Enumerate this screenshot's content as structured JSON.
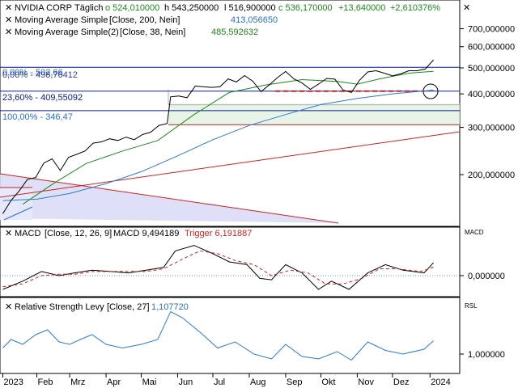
{
  "colors": {
    "price": "#000000",
    "sma200": "#2a7bd4",
    "sma38": "#1a8a1a",
    "fib_line": "#0a1a8a",
    "red_line": "#cc2222",
    "macd": "#000000",
    "trigger": "#cc2222",
    "rsl": "#2a7bd4",
    "green_label": "#1a8a1a",
    "blue_label": "#2a6fd0",
    "red_label": "#cc2222",
    "fib_text": "#0a1a8a"
  },
  "header": {
    "symbol": "NVIDIA CORP",
    "period": "Täglich",
    "open": "o 524,010000",
    "high": "h 543,250000",
    "low": "l 516,900000",
    "close": "c 536,170000",
    "change": "+13,640000",
    "change_pct": "+2,610376%",
    "sma1_label": "Moving Average Simple",
    "sma1_params": "[Close, 200, Nein]",
    "sma1_value": "413,056650",
    "sma2_label": "Moving Average Simple(2)",
    "sma2_params": "[Close, 38, Nein]",
    "sma2_value": "485,592632",
    "close_icon": "close-x"
  },
  "price_axis": {
    "ticks": [
      "700,000000",
      "600,000000",
      "500,000000",
      "400,000000",
      "300,000000",
      "200,000000"
    ]
  },
  "fib_levels": {
    "label_0": "0,00% - 502,66",
    "label_0b": "0,00% - 498,76412",
    "label_236": "23,60% - 409,55092",
    "label_100": "100,00% - 346,47"
  },
  "macd": {
    "label": "MACD",
    "params": "[Close, 12, 26, 9]",
    "value_text": "MACD 9,494189",
    "trigger_text": "Trigger 6,191887",
    "axis_title": "MACD",
    "axis_zero": "0,000000"
  },
  "rsl": {
    "label": "Relative Strength Levy",
    "params": "[Close, 27]",
    "value": "1,107720",
    "axis_title": "RSL",
    "axis_one": "1,000000"
  },
  "x_axis": {
    "labels": [
      "2023",
      "Feb",
      "Mrz",
      "Apr",
      "Mai",
      "Jun",
      "Jul",
      "Aug",
      "Sep",
      "Okt",
      "Nov",
      "Dez",
      "2024"
    ]
  },
  "chart_data": {
    "type": "line",
    "title": "NVIDIA CORP",
    "ylim": [
      130,
      760
    ],
    "y_scale": "log",
    "grid": false,
    "price_close": [
      [
        "2023-01-03",
        143
      ],
      [
        "2023-01-10",
        160
      ],
      [
        "2023-01-17",
        174
      ],
      [
        "2023-01-24",
        192
      ],
      [
        "2023-01-31",
        195
      ],
      [
        "2023-02-07",
        221
      ],
      [
        "2023-02-14",
        229
      ],
      [
        "2023-02-21",
        207
      ],
      [
        "2023-02-28",
        232
      ],
      [
        "2023-03-07",
        238
      ],
      [
        "2023-03-14",
        245
      ],
      [
        "2023-03-21",
        262
      ],
      [
        "2023-03-28",
        265
      ],
      [
        "2023-04-04",
        272
      ],
      [
        "2023-04-11",
        268
      ],
      [
        "2023-04-18",
        276
      ],
      [
        "2023-04-25",
        270
      ],
      [
        "2023-05-02",
        282
      ],
      [
        "2023-05-09",
        288
      ],
      [
        "2023-05-16",
        305
      ],
      [
        "2023-05-23",
        310
      ],
      [
        "2023-05-26",
        390
      ],
      [
        "2023-06-02",
        393
      ],
      [
        "2023-06-09",
        387
      ],
      [
        "2023-06-16",
        428
      ],
      [
        "2023-06-23",
        425
      ],
      [
        "2023-06-30",
        423
      ],
      [
        "2023-07-07",
        425
      ],
      [
        "2023-07-14",
        455
      ],
      [
        "2023-07-21",
        443
      ],
      [
        "2023-07-28",
        468
      ],
      [
        "2023-08-04",
        446
      ],
      [
        "2023-08-11",
        408
      ],
      [
        "2023-08-18",
        432
      ],
      [
        "2023-08-25",
        460
      ],
      [
        "2023-09-01",
        485
      ],
      [
        "2023-09-08",
        455
      ],
      [
        "2023-09-15",
        439
      ],
      [
        "2023-09-22",
        416
      ],
      [
        "2023-09-29",
        435
      ],
      [
        "2023-10-06",
        457
      ],
      [
        "2023-10-13",
        454
      ],
      [
        "2023-10-20",
        413
      ],
      [
        "2023-10-27",
        405
      ],
      [
        "2023-11-03",
        450
      ],
      [
        "2023-11-10",
        483
      ],
      [
        "2023-11-17",
        488
      ],
      [
        "2023-11-24",
        478
      ],
      [
        "2023-12-01",
        467
      ],
      [
        "2023-12-08",
        475
      ],
      [
        "2023-12-15",
        488
      ],
      [
        "2023-12-22",
        488
      ],
      [
        "2023-12-29",
        495
      ],
      [
        "2024-01-05",
        536
      ]
    ],
    "sma200": [
      [
        "2023-01-03",
        160
      ],
      [
        "2023-02-01",
        162
      ],
      [
        "2023-03-01",
        170
      ],
      [
        "2023-04-01",
        185
      ],
      [
        "2023-05-01",
        205
      ],
      [
        "2023-06-01",
        235
      ],
      [
        "2023-07-01",
        270
      ],
      [
        "2023-08-01",
        305
      ],
      [
        "2023-09-01",
        335
      ],
      [
        "2023-10-01",
        365
      ],
      [
        "2023-11-01",
        385
      ],
      [
        "2023-12-01",
        400
      ],
      [
        "2024-01-05",
        413.06
      ]
    ],
    "sma38": [
      [
        "2023-01-20",
        155
      ],
      [
        "2023-02-15",
        185
      ],
      [
        "2023-03-15",
        220
      ],
      [
        "2023-04-15",
        245
      ],
      [
        "2023-05-15",
        268
      ],
      [
        "2023-06-15",
        335
      ],
      [
        "2023-07-15",
        405
      ],
      [
        "2023-08-15",
        432
      ],
      [
        "2023-09-15",
        452
      ],
      [
        "2023-10-15",
        445
      ],
      [
        "2023-11-01",
        435
      ],
      [
        "2023-11-20",
        455
      ],
      [
        "2023-12-15",
        478
      ],
      [
        "2024-01-05",
        485.59
      ]
    ],
    "fib_levels": [
      502.66,
      498.76412,
      409.55092,
      346.47
    ],
    "horizontal_lines": [
      502.66,
      409.55,
      346.47,
      307
    ],
    "macd_series": [
      [
        "2023-01-03",
        -10
      ],
      [
        "2023-01-20",
        -4
      ],
      [
        "2023-02-05",
        3
      ],
      [
        "2023-02-20",
        0
      ],
      [
        "2023-03-05",
        2
      ],
      [
        "2023-03-20",
        4
      ],
      [
        "2023-04-05",
        3
      ],
      [
        "2023-04-20",
        2
      ],
      [
        "2023-05-05",
        4
      ],
      [
        "2023-05-20",
        6
      ],
      [
        "2023-05-30",
        18
      ],
      [
        "2023-06-15",
        22
      ],
      [
        "2023-07-01",
        16
      ],
      [
        "2023-07-15",
        10
      ],
      [
        "2023-07-30",
        8
      ],
      [
        "2023-08-10",
        -2
      ],
      [
        "2023-08-20",
        -3
      ],
      [
        "2023-09-01",
        8
      ],
      [
        "2023-09-15",
        2
      ],
      [
        "2023-09-29",
        -10
      ],
      [
        "2023-10-10",
        -4
      ],
      [
        "2023-10-25",
        -10
      ],
      [
        "2023-11-10",
        2
      ],
      [
        "2023-11-25",
        8
      ],
      [
        "2023-12-10",
        4
      ],
      [
        "2023-12-28",
        2
      ],
      [
        "2024-01-05",
        9.49
      ]
    ],
    "trigger_series": [
      [
        "2023-01-03",
        -8
      ],
      [
        "2023-01-20",
        -6
      ],
      [
        "2023-02-05",
        0
      ],
      [
        "2023-02-20",
        1
      ],
      [
        "2023-03-05",
        1
      ],
      [
        "2023-03-20",
        3
      ],
      [
        "2023-04-05",
        3
      ],
      [
        "2023-04-20",
        3
      ],
      [
        "2023-05-05",
        3
      ],
      [
        "2023-05-20",
        5
      ],
      [
        "2023-06-05",
        12
      ],
      [
        "2023-06-20",
        18
      ],
      [
        "2023-07-05",
        16
      ],
      [
        "2023-07-20",
        11
      ],
      [
        "2023-08-05",
        8
      ],
      [
        "2023-08-20",
        0
      ],
      [
        "2023-09-05",
        4
      ],
      [
        "2023-09-20",
        2
      ],
      [
        "2023-10-05",
        -6
      ],
      [
        "2023-10-20",
        -6
      ],
      [
        "2023-11-05",
        -2
      ],
      [
        "2023-11-20",
        5
      ],
      [
        "2023-12-05",
        5
      ],
      [
        "2023-12-25",
        3
      ],
      [
        "2024-01-05",
        6.19
      ]
    ],
    "rsl_series": [
      [
        "2023-01-03",
        1.05
      ],
      [
        "2023-01-10",
        1.12
      ],
      [
        "2023-01-20",
        1.08
      ],
      [
        "2023-01-31",
        1.16
      ],
      [
        "2023-02-10",
        1.2
      ],
      [
        "2023-02-20",
        1.1
      ],
      [
        "2023-03-01",
        1.08
      ],
      [
        "2023-03-10",
        1.12
      ],
      [
        "2023-03-20",
        1.16
      ],
      [
        "2023-04-01",
        1.08
      ],
      [
        "2023-04-15",
        1.05
      ],
      [
        "2023-05-01",
        1.08
      ],
      [
        "2023-05-15",
        1.12
      ],
      [
        "2023-05-26",
        1.35
      ],
      [
        "2023-06-05",
        1.3
      ],
      [
        "2023-06-20",
        1.18
      ],
      [
        "2023-07-05",
        1.05
      ],
      [
        "2023-07-20",
        1.1
      ],
      [
        "2023-08-05",
        1.0
      ],
      [
        "2023-08-20",
        0.96
      ],
      [
        "2023-09-01",
        1.08
      ],
      [
        "2023-09-15",
        0.98
      ],
      [
        "2023-09-29",
        0.96
      ],
      [
        "2023-10-15",
        1.02
      ],
      [
        "2023-10-27",
        0.95
      ],
      [
        "2023-11-10",
        1.1
      ],
      [
        "2023-11-25",
        1.03
      ],
      [
        "2023-12-10",
        1.0
      ],
      [
        "2023-12-28",
        1.04
      ],
      [
        "2024-01-05",
        1.11
      ]
    ]
  }
}
